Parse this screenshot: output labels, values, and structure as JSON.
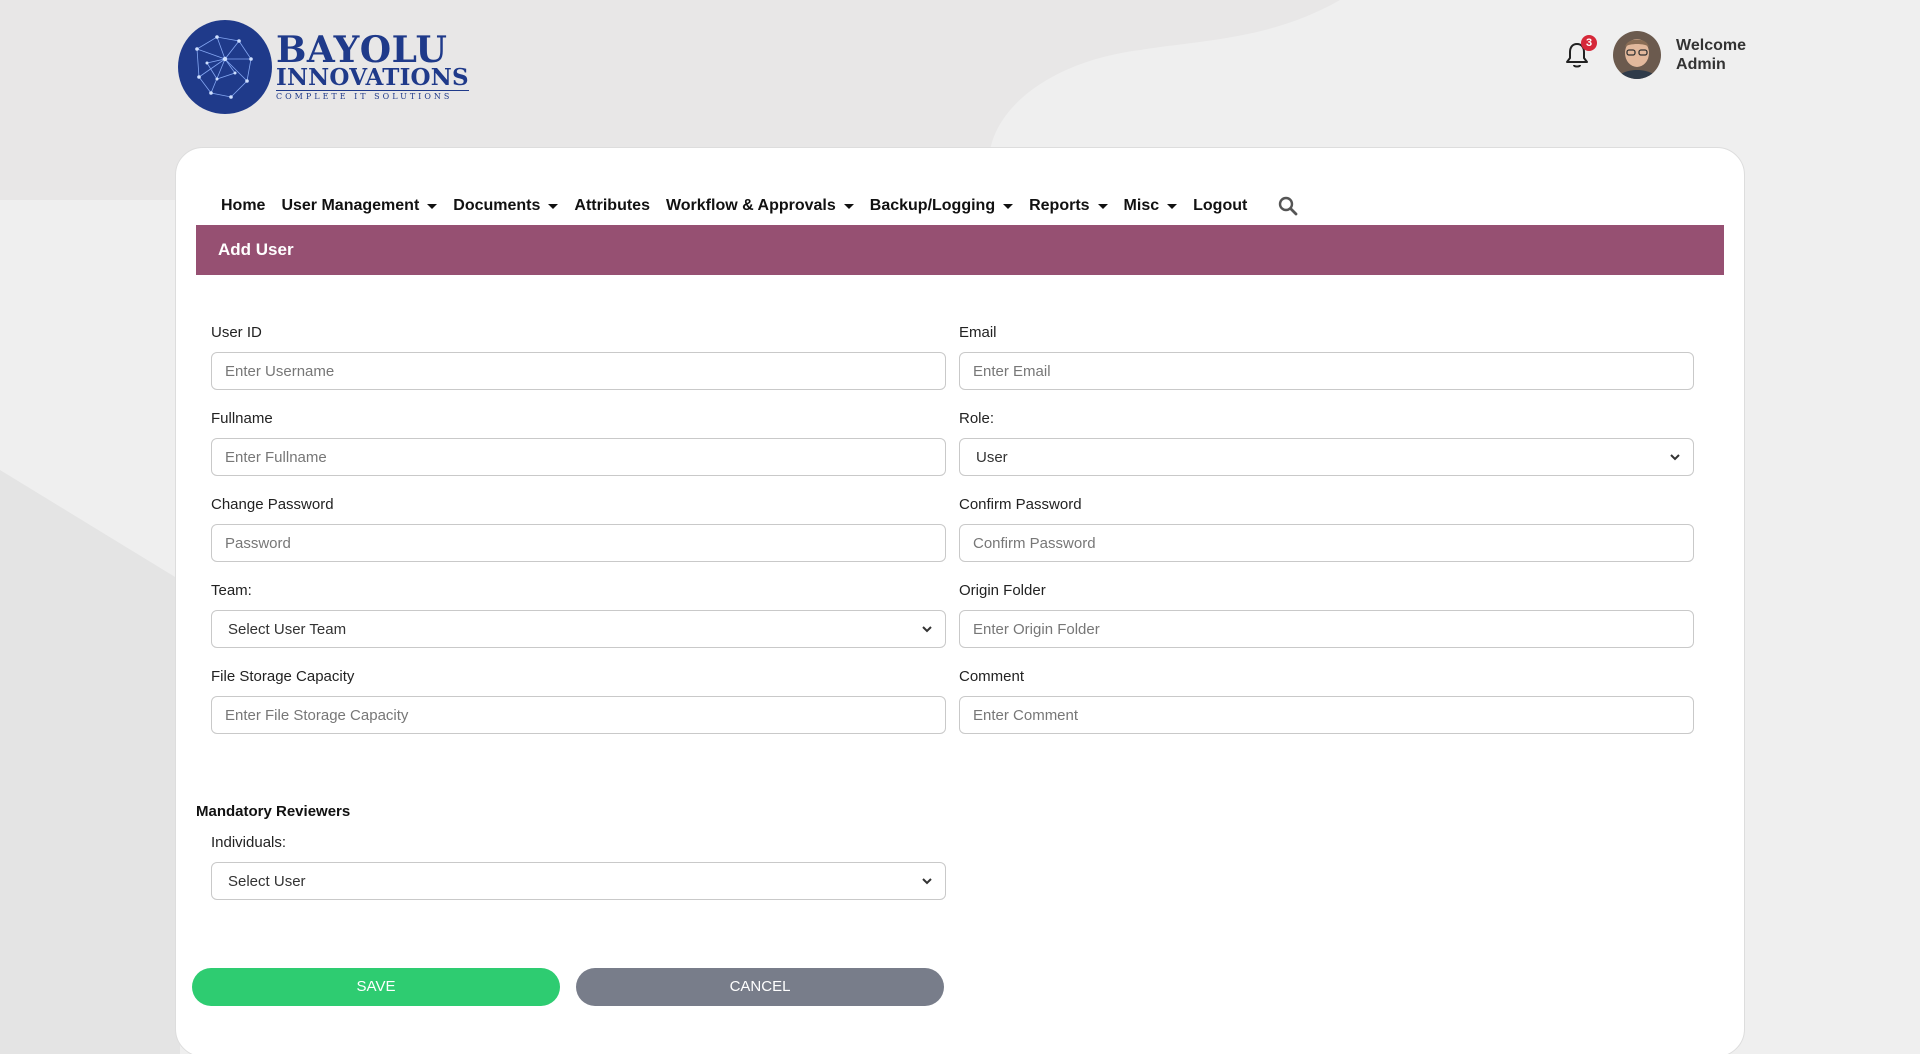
{
  "brand": {
    "word1": "BAYOLU",
    "word2": "INNOVATIONS",
    "tagline": "COMPLETE IT SOLUTIONS"
  },
  "header": {
    "notification_count": "3",
    "welcome_line1": "Welcome",
    "welcome_line2": "Admin"
  },
  "nav": {
    "items": [
      {
        "label": "Home",
        "dropdown": false
      },
      {
        "label": "User Management",
        "dropdown": true
      },
      {
        "label": "Documents",
        "dropdown": true
      },
      {
        "label": "Attributes",
        "dropdown": false
      },
      {
        "label": "Workflow & Approvals",
        "dropdown": true
      },
      {
        "label": "Backup/Logging",
        "dropdown": true
      },
      {
        "label": "Reports",
        "dropdown": true
      },
      {
        "label": "Misc",
        "dropdown": true
      },
      {
        "label": "Logout",
        "dropdown": false
      }
    ]
  },
  "page": {
    "title": "Add User"
  },
  "form": {
    "user_id": {
      "label": "User ID",
      "placeholder": "Enter Username"
    },
    "email": {
      "label": "Email",
      "placeholder": "Enter Email"
    },
    "fullname": {
      "label": "Fullname",
      "placeholder": "Enter Fullname"
    },
    "role": {
      "label": "Role:",
      "value": "User"
    },
    "password": {
      "label": "Change Password",
      "placeholder": "Password"
    },
    "confirm_password": {
      "label": "Confirm Password",
      "placeholder": "Confirm Password"
    },
    "team": {
      "label": "Team:",
      "value": "Select User Team"
    },
    "origin_folder": {
      "label": "Origin Folder",
      "placeholder": "Enter Origin Folder"
    },
    "storage": {
      "label": "File Storage Capacity",
      "placeholder": "Enter File Storage Capacity"
    },
    "comment": {
      "label": "Comment",
      "placeholder": "Enter Comment"
    }
  },
  "reviewers": {
    "section_title": "Mandatory Reviewers",
    "individuals_label": "Individuals:",
    "individuals_value": "Select User"
  },
  "buttons": {
    "save": "SAVE",
    "cancel": "CANCEL"
  },
  "colors": {
    "title_bar": "#965072",
    "save": "#2ecc71",
    "cancel": "#787d8a",
    "brand": "#1f3a8a",
    "badge": "#d62839"
  }
}
